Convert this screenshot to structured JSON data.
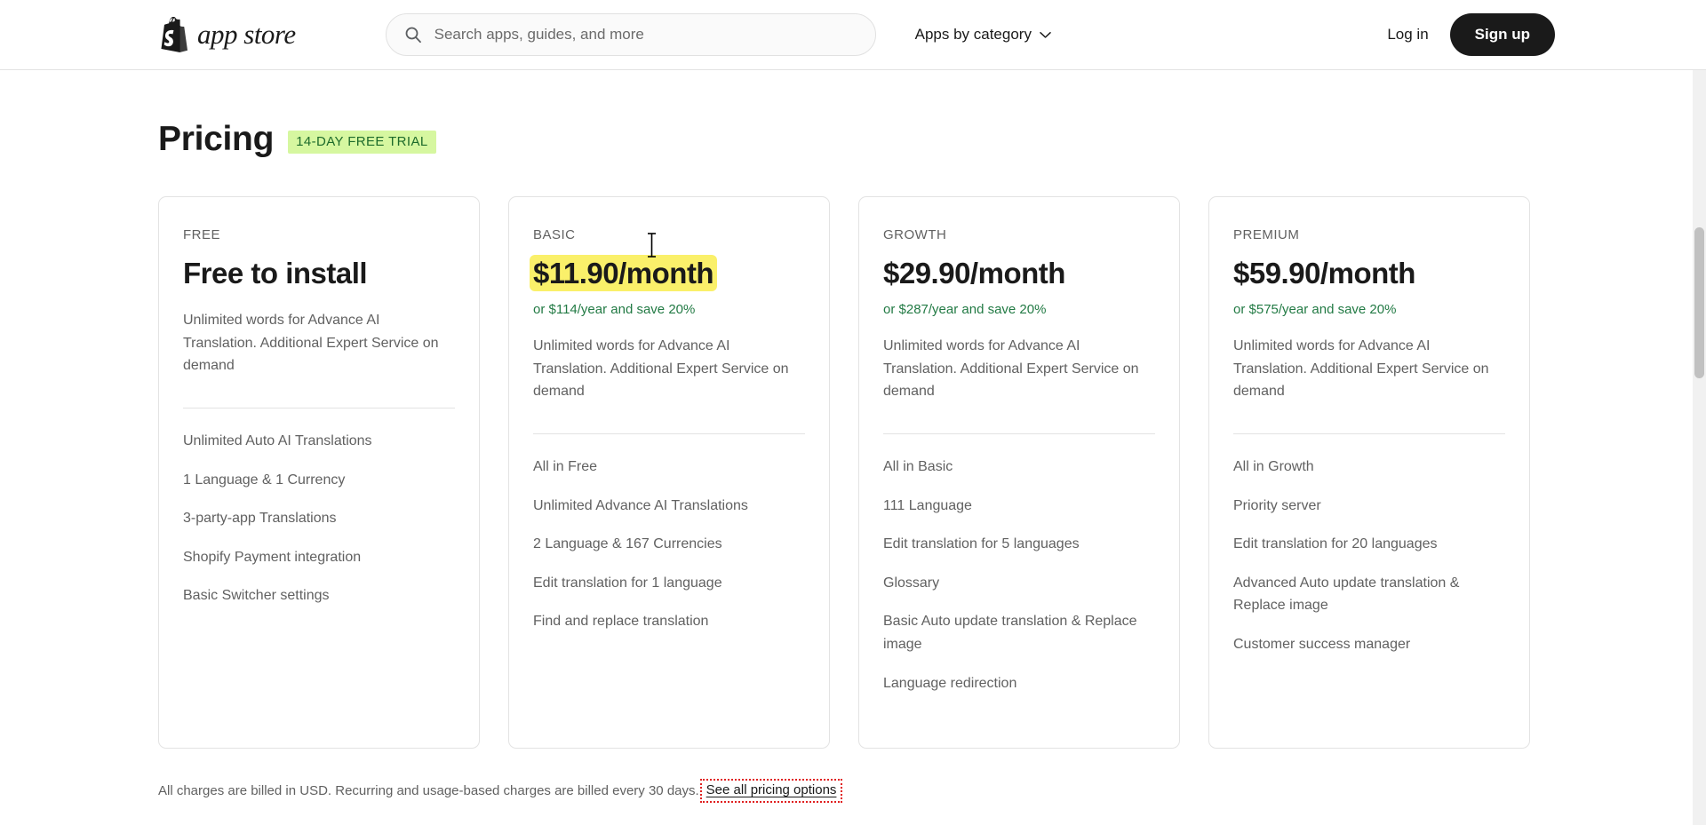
{
  "header": {
    "logo_text": "app store",
    "logo_icon": "shopify-bag-icon",
    "search": {
      "icon": "search-icon",
      "placeholder": "Search apps, guides, and more",
      "value": ""
    },
    "category_nav": {
      "label": "Apps by category",
      "icon": "chevron-down-icon"
    },
    "login_label": "Log in",
    "signup_label": "Sign up"
  },
  "pricing": {
    "title": "Pricing",
    "trial_badge": "14-DAY FREE TRIAL",
    "accent_green": "#227a44",
    "badge_bg": "#d6f7a0",
    "badge_text_color": "#1d6b2b",
    "highlight_color": "#faf06a",
    "annotation_color": "#e02020",
    "plans": [
      {
        "name": "FREE",
        "price": "Free to install",
        "price_highlighted": false,
        "yearly": "",
        "description": "Unlimited words for Advance AI Translation. Additional Expert Service on demand",
        "features": [
          "Unlimited Auto AI Translations",
          "1 Language & 1 Currency",
          "3-party-app Translations",
          "Shopify Payment integration",
          "Basic Switcher settings"
        ]
      },
      {
        "name": "BASIC",
        "price": "$11.90/month",
        "price_highlighted": true,
        "yearly": "or $114/year and save 20%",
        "description": "Unlimited words for Advance AI Translation. Additional Expert Service on demand",
        "features": [
          "All in Free",
          "Unlimited Advance AI Translations",
          "2 Language & 167 Currencies",
          "Edit translation for 1 language",
          "Find and replace translation"
        ]
      },
      {
        "name": "GROWTH",
        "price": "$29.90/month",
        "price_highlighted": false,
        "yearly": "or $287/year and save 20%",
        "description": "Unlimited words for Advance AI Translation. Additional Expert Service on demand",
        "features": [
          "All in Basic",
          "111 Language",
          "Edit translation for 5 languages",
          "Glossary",
          "Basic Auto update translation & Replace image",
          "Language redirection"
        ]
      },
      {
        "name": "PREMIUM",
        "price": "$59.90/month",
        "price_highlighted": false,
        "yearly": "or $575/year and save 20%",
        "description": "Unlimited words for Advance AI Translation. Additional Expert Service on demand",
        "features": [
          "All in Growth",
          "Priority server",
          "Edit translation for 20 languages",
          "Advanced Auto update translation & Replace image",
          "Customer success manager"
        ]
      }
    ],
    "footnote": "All charges are billed in USD. Recurring and usage-based charges are billed every 30 days.",
    "footnote_link": "See all pricing options"
  }
}
